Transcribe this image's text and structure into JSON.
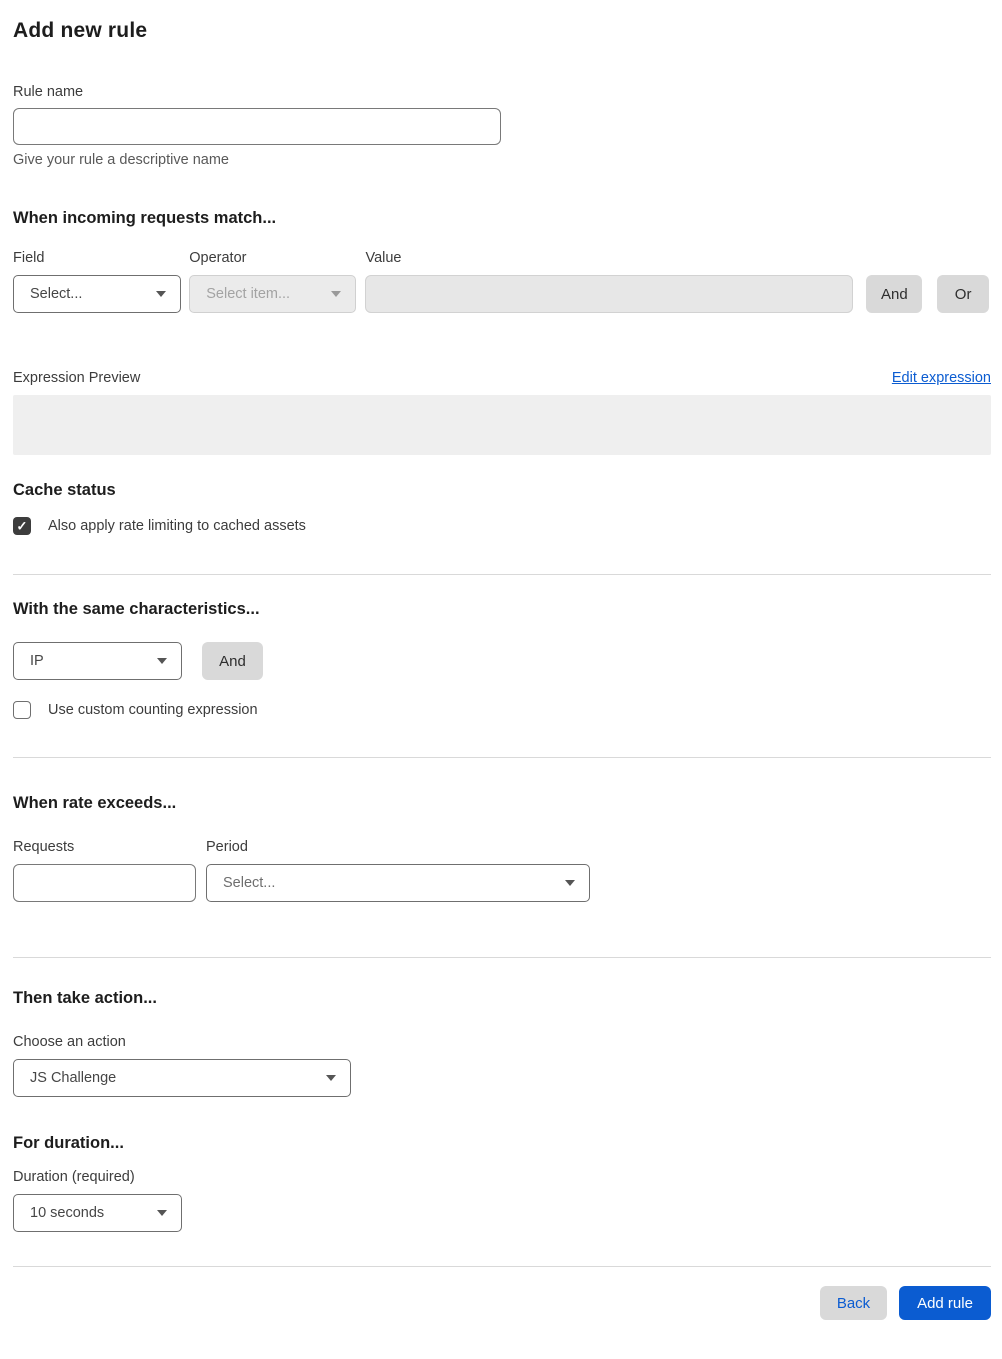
{
  "page": {
    "title": "Add new rule"
  },
  "rule_name": {
    "label": "Rule name",
    "value": "",
    "helper": "Give your rule a descriptive name"
  },
  "match_section": {
    "heading": "When incoming requests match...",
    "field_label": "Field",
    "field_value": "Select...",
    "operator_label": "Operator",
    "operator_value": "Select item...",
    "value_label": "Value",
    "value_value": "",
    "and_label": "And",
    "or_label": "Or"
  },
  "expression": {
    "label": "Expression Preview",
    "edit_link": "Edit expression",
    "content": ""
  },
  "cache": {
    "heading": "Cache status",
    "checkbox_label": "Also apply rate limiting to cached assets",
    "checked": true,
    "check_glyph": "✓"
  },
  "characteristics": {
    "heading": "With the same characteristics...",
    "select_value": "IP",
    "and_label": "And",
    "checkbox_label": "Use custom counting expression",
    "checked": false
  },
  "rate": {
    "heading": "When rate exceeds...",
    "requests_label": "Requests",
    "requests_value": "",
    "period_label": "Period",
    "period_value": "Select..."
  },
  "action": {
    "heading": "Then take action...",
    "label": "Choose an action",
    "value": "JS Challenge"
  },
  "duration": {
    "heading": "For duration...",
    "label": "Duration (required)",
    "value": "10 seconds"
  },
  "footer": {
    "back_label": "Back",
    "add_label": "Add rule"
  },
  "colors": {
    "accent_blue": "#0b5cd1",
    "checkbox_checked": "#3d3d3d",
    "divider": "#d9d9d9",
    "disabled_bg": "#ebebeb",
    "preview_bg": "#efefef"
  }
}
